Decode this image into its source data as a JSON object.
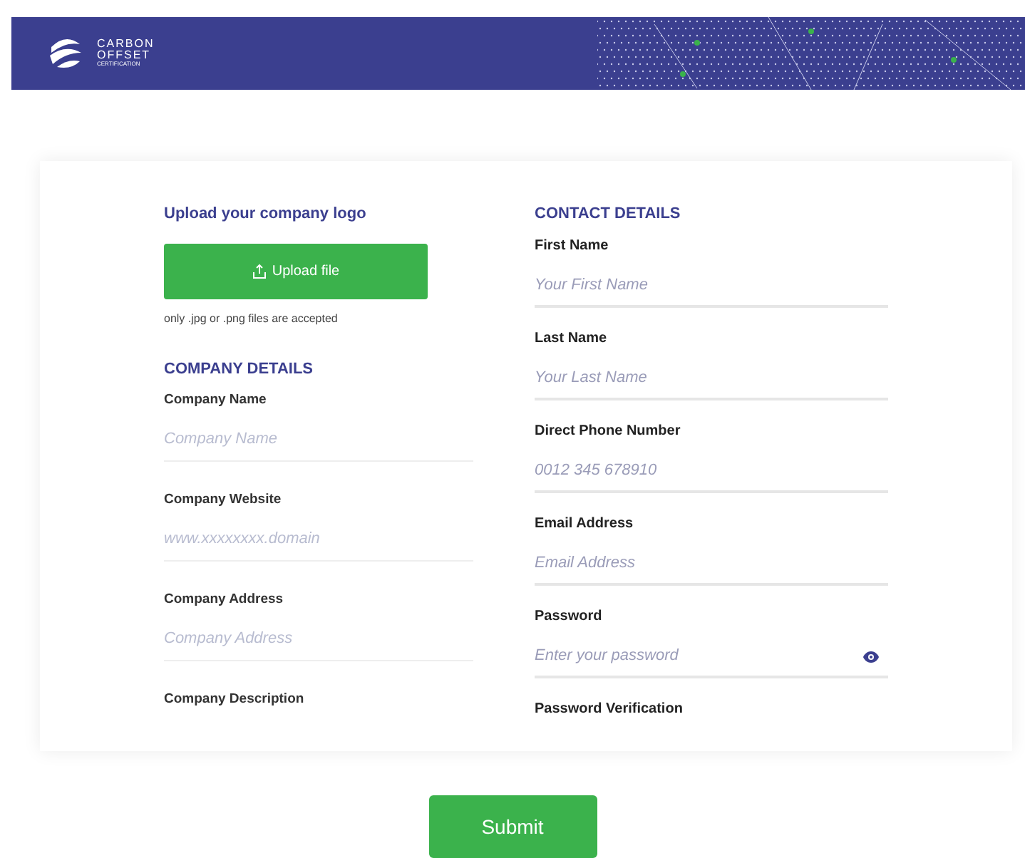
{
  "header": {
    "logo_lines": [
      "CARBON",
      "OFFSET",
      "CERTIFICATION"
    ]
  },
  "upload": {
    "title": "Upload your company logo",
    "button": "Upload file",
    "note": "only .jpg or .png files are accepted"
  },
  "company_details": {
    "title": "COMPANY DETAILS",
    "fields": [
      {
        "label": "Company Name",
        "placeholder": "Company Name"
      },
      {
        "label": "Company Website",
        "placeholder": "www.xxxxxxxx.domain"
      },
      {
        "label": "Company Address",
        "placeholder": "Company Address"
      },
      {
        "label": "Company Description"
      }
    ]
  },
  "contact_details": {
    "title": "CONTACT DETAILS",
    "fields": [
      {
        "label": "First Name",
        "placeholder": "Your First Name",
        "kind": "text"
      },
      {
        "label": "Last Name",
        "placeholder": "Your Last Name",
        "kind": "text"
      },
      {
        "label": "Direct Phone Number",
        "placeholder": "0012 345 678910",
        "kind": "text"
      },
      {
        "label": "Email Address",
        "placeholder": "Email Address",
        "kind": "text"
      },
      {
        "label": "Password",
        "placeholder": "Enter your password",
        "kind": "password"
      },
      {
        "label": "Password Verification"
      }
    ]
  },
  "submit": "Submit"
}
